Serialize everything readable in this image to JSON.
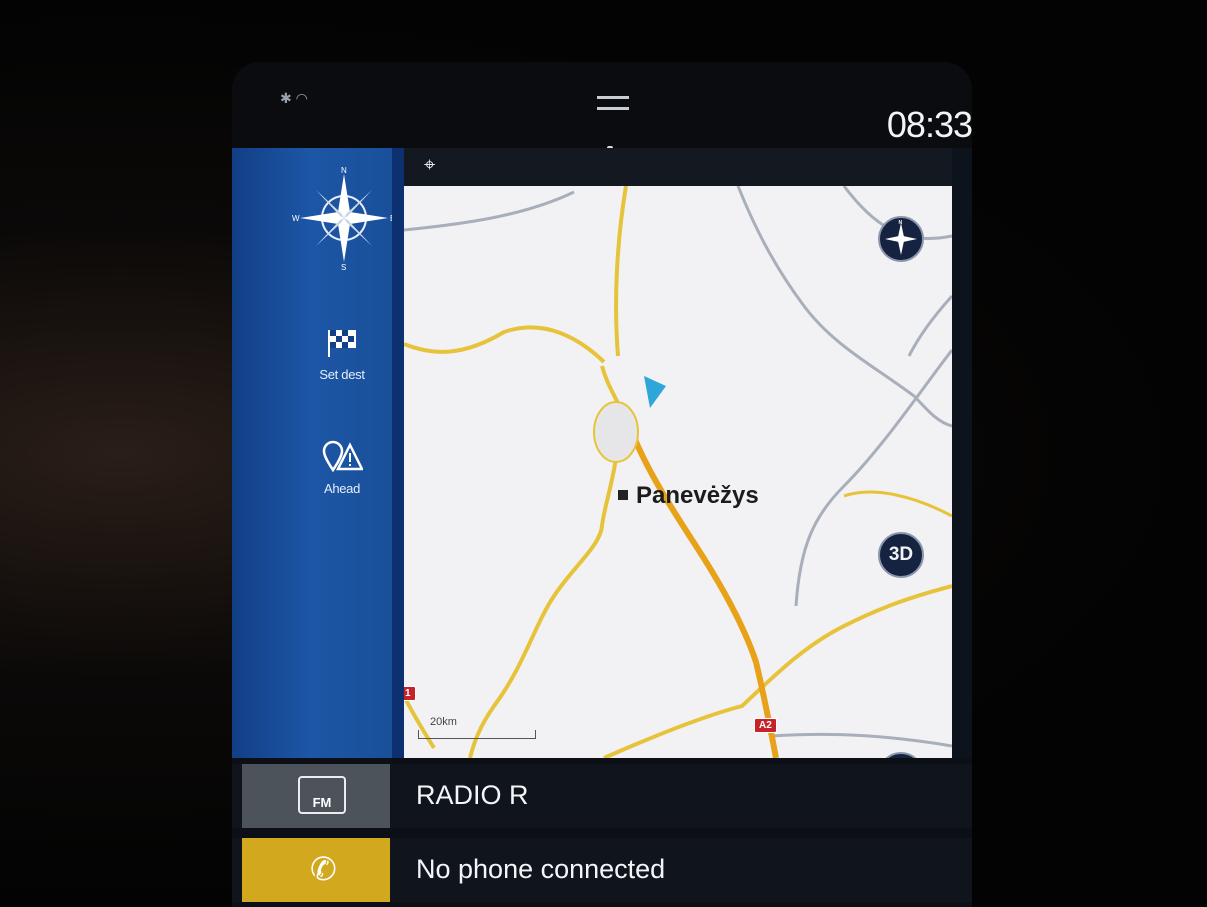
{
  "status": {
    "clock": "08:33",
    "wifi_icon": "wifi-icon",
    "bluetooth_icon": "bluetooth-icon"
  },
  "sidebar": {
    "compass_icon": "compass-rose-icon",
    "set_dest": {
      "label": "Set dest",
      "icon": "checkered-flag-icon"
    },
    "ahead": {
      "label": "Ahead",
      "icon": "poi-warning-icon"
    }
  },
  "map": {
    "city": "Panevėžys",
    "road_shield_a2": "A2",
    "road_shield_left": "1",
    "scale_label": "20km",
    "button_3d": "3D",
    "colors": {
      "highway": "#e8a21a",
      "main_road": "#e6c33a",
      "minor_road": "#a9aebb",
      "position_arrow": "#2fa6d8"
    }
  },
  "tiles": {
    "radio": {
      "label": "RADIO R",
      "icon_text": "FM"
    },
    "phone": {
      "label": "No phone connected",
      "icon": "phone-icon"
    }
  }
}
